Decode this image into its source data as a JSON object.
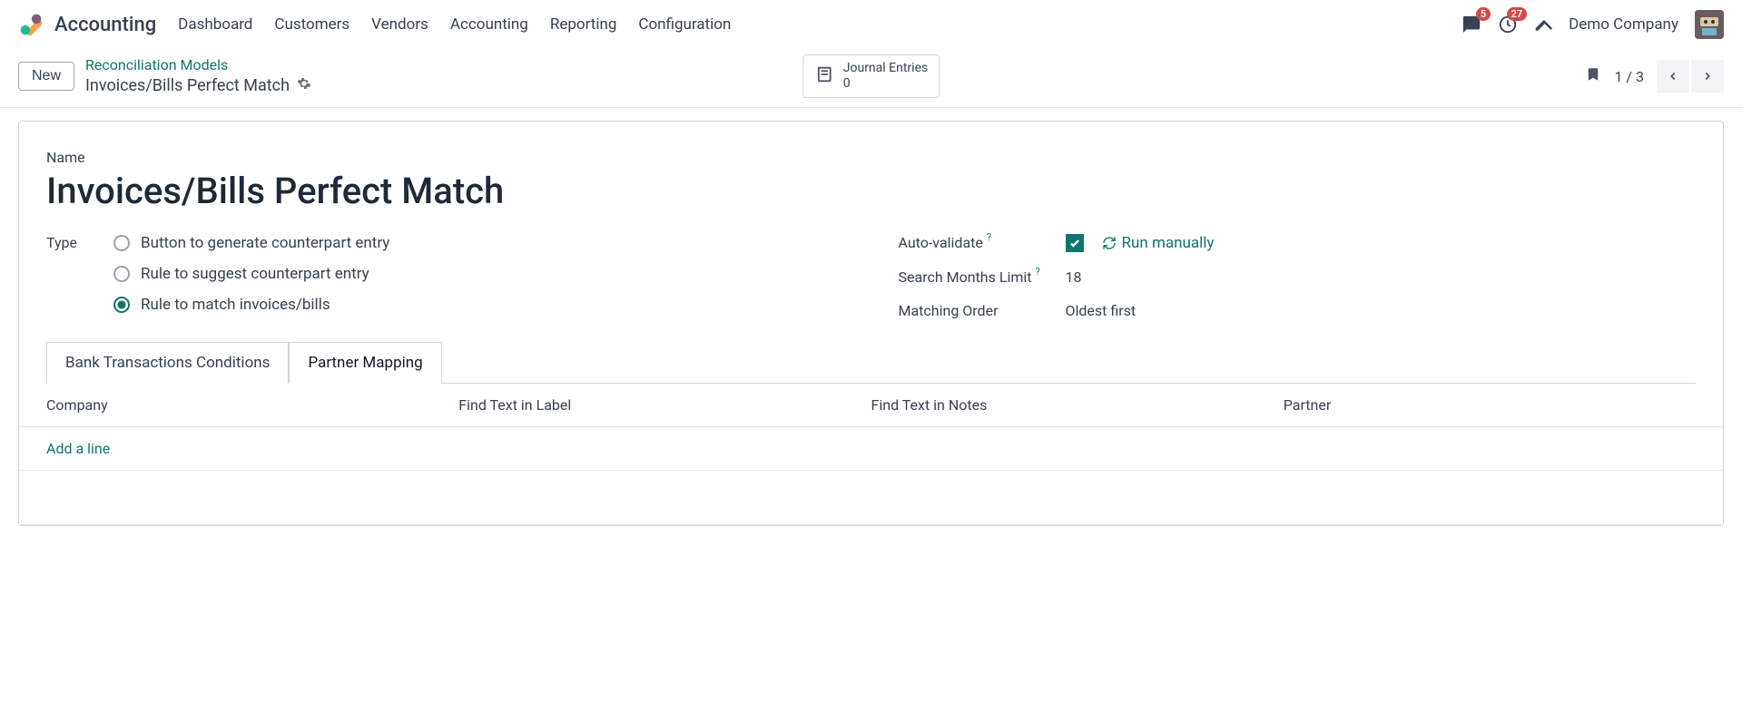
{
  "nav": {
    "app_title": "Accounting",
    "menu": [
      "Dashboard",
      "Customers",
      "Vendors",
      "Accounting",
      "Reporting",
      "Configuration"
    ],
    "messages_badge": "5",
    "activities_badge": "27",
    "company": "Demo Company"
  },
  "controlbar": {
    "new_label": "New",
    "breadcrumb_parent": "Reconciliation Models",
    "breadcrumb_current": "Invoices/Bills Perfect Match",
    "smart_button": {
      "title": "Journal Entries",
      "count": "0"
    },
    "pager": "1 / 3"
  },
  "form": {
    "name_label": "Name",
    "name_value": "Invoices/Bills Perfect Match",
    "type_label": "Type",
    "type_options": [
      "Button to generate counterpart entry",
      "Rule to suggest counterpart entry",
      "Rule to match invoices/bills"
    ],
    "type_selected_index": 2,
    "auto_validate_label": "Auto-validate",
    "auto_validate_checked": true,
    "run_manually_label": "Run manually",
    "search_months_label": "Search Months Limit",
    "search_months_value": "18",
    "matching_order_label": "Matching Order",
    "matching_order_value": "Oldest first"
  },
  "tabs": {
    "items": [
      "Bank Transactions Conditions",
      "Partner Mapping"
    ],
    "active_index": 1
  },
  "grid": {
    "columns": [
      "Company",
      "Find Text in Label",
      "Find Text in Notes",
      "Partner"
    ],
    "add_line_label": "Add a line"
  }
}
